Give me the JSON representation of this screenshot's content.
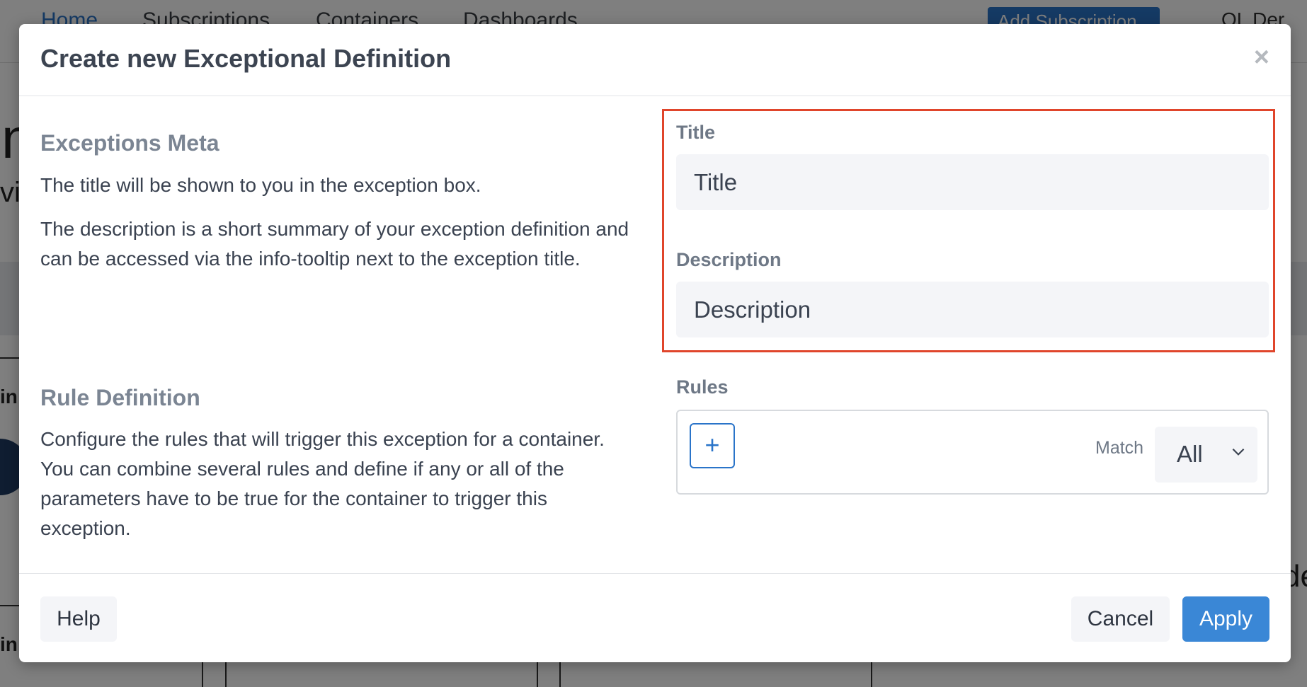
{
  "background": {
    "nav": [
      "Home",
      "Subscriptions",
      "Containers",
      "Dashboards"
    ],
    "add_button": "Add Subscription",
    "user": "OL Der",
    "fragments": [
      "n",
      "vis",
      "in",
      "in",
      "de"
    ]
  },
  "modal": {
    "title": "Create new Exceptional Definition",
    "close_label": "×",
    "meta": {
      "heading": "Exceptions Meta",
      "text1": "The title will be shown to you in the exception box.",
      "text2": "The description is a short summary of your exception definition and can be accessed via the info-tooltip next to the exception title."
    },
    "rule_def": {
      "heading": "Rule Definition",
      "text": "Configure the rules that will trigger this exception for a container. You can combine several rules and define if any or all of the parameters have to be true for the container to trigger this exception."
    },
    "fields": {
      "title_label": "Title",
      "title_placeholder": "Title",
      "description_label": "Description",
      "description_placeholder": "Description"
    },
    "rules": {
      "label": "Rules",
      "add_icon": "+",
      "match_label": "Match",
      "match_value": "All"
    },
    "footer": {
      "help": "Help",
      "cancel": "Cancel",
      "apply": "Apply"
    }
  },
  "colors": {
    "primary": "#3a87d6",
    "highlight": "#e0452b"
  }
}
